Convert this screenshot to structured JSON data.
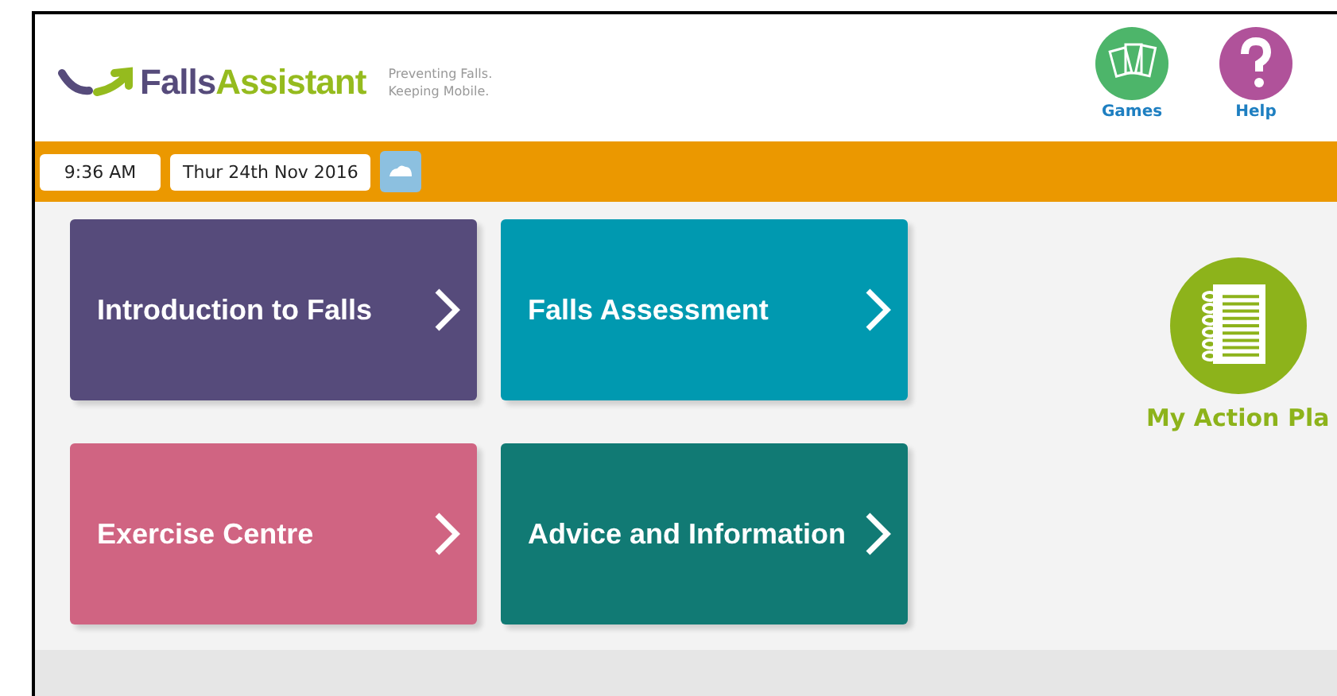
{
  "logo": {
    "first": "Falls",
    "second": "Assistant"
  },
  "tagline": [
    "Preventing Falls.",
    "Keeping Mobile."
  ],
  "header_buttons": [
    {
      "kind": "games",
      "label": "Games",
      "color": "#4db56a"
    },
    {
      "kind": "help",
      "label": "Help",
      "color": "#b0529a"
    }
  ],
  "time": "9:36 AM",
  "date": "Thur 24th Nov 2016",
  "tiles": [
    {
      "label": "Introduction to Falls",
      "color": "#564b7b"
    },
    {
      "label": "Falls Assessment",
      "color": "#0099b0"
    },
    {
      "label": "Exercise Centre",
      "color": "#d06482"
    },
    {
      "label": "Advice and Information",
      "color": "#117a74"
    }
  ],
  "action_plan": {
    "label": "My Action Pla"
  }
}
